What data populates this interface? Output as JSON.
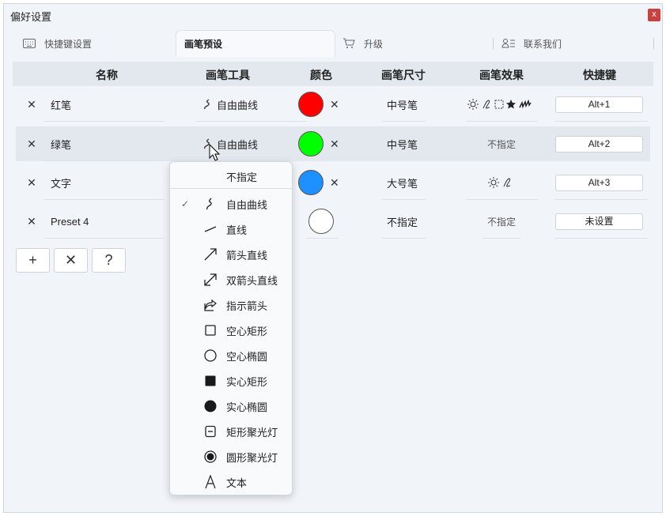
{
  "window": {
    "title": "偏好设置",
    "close_label": "x"
  },
  "tabs": [
    {
      "label": "快捷键设置",
      "icon": "keyboard-icon"
    },
    {
      "label": "画笔预设",
      "icon": "",
      "active": true
    },
    {
      "label": "升级",
      "icon": "cart-icon"
    },
    {
      "label": "联系我们",
      "icon": "contacts-icon"
    }
  ],
  "table": {
    "headers": [
      "名称",
      "画笔工具",
      "颜色",
      "画笔尺寸",
      "画笔效果",
      "快捷键"
    ],
    "rows": [
      {
        "name": "红笔",
        "tool": "自由曲线",
        "color": "#ff0000",
        "size": "中号笔",
        "effect": "",
        "effect_icons": [
          "brightness-icon",
          "pen-icon",
          "dashed-box-icon",
          "star-icon",
          "squiggle-icon"
        ],
        "hotkey": "Alt+1"
      },
      {
        "name": "绿笔",
        "tool": "自由曲线",
        "color": "#00ff00",
        "size": "中号笔",
        "effect": "不指定",
        "hotkey": "Alt+2"
      },
      {
        "name": "文字",
        "tool": "",
        "color": "#1e90ff",
        "size": "大号笔",
        "effect": "",
        "effect_icons": [
          "brightness-icon",
          "pen-icon"
        ],
        "hotkey": "Alt+3"
      },
      {
        "name": "Preset 4",
        "tool": "",
        "color": "#ffffff",
        "size": "不指定",
        "effect": "不指定",
        "hotkey": "未设置"
      }
    ]
  },
  "actions": {
    "add": "+",
    "remove": "✕",
    "help": "?"
  },
  "dropdown": {
    "first": "不指定",
    "items": [
      {
        "label": "自由曲线",
        "icon": "freehand-icon",
        "checked": true
      },
      {
        "label": "直线",
        "icon": "line-icon"
      },
      {
        "label": "箭头直线",
        "icon": "arrow-line-icon"
      },
      {
        "label": "双箭头直线",
        "icon": "double-arrow-icon"
      },
      {
        "label": "指示箭头",
        "icon": "share-arrow-icon"
      },
      {
        "label": "空心矩形",
        "icon": "hollow-rect-icon"
      },
      {
        "label": "空心椭圆",
        "icon": "hollow-ellipse-icon"
      },
      {
        "label": "实心矩形",
        "icon": "solid-rect-icon"
      },
      {
        "label": "实心椭圆",
        "icon": "solid-ellipse-icon"
      },
      {
        "label": "矩形聚光灯",
        "icon": "rect-spotlight-icon"
      },
      {
        "label": "圆形聚光灯",
        "icon": "circle-spotlight-icon"
      },
      {
        "label": "文本",
        "icon": "text-icon"
      }
    ],
    "check_mark": "✓"
  }
}
